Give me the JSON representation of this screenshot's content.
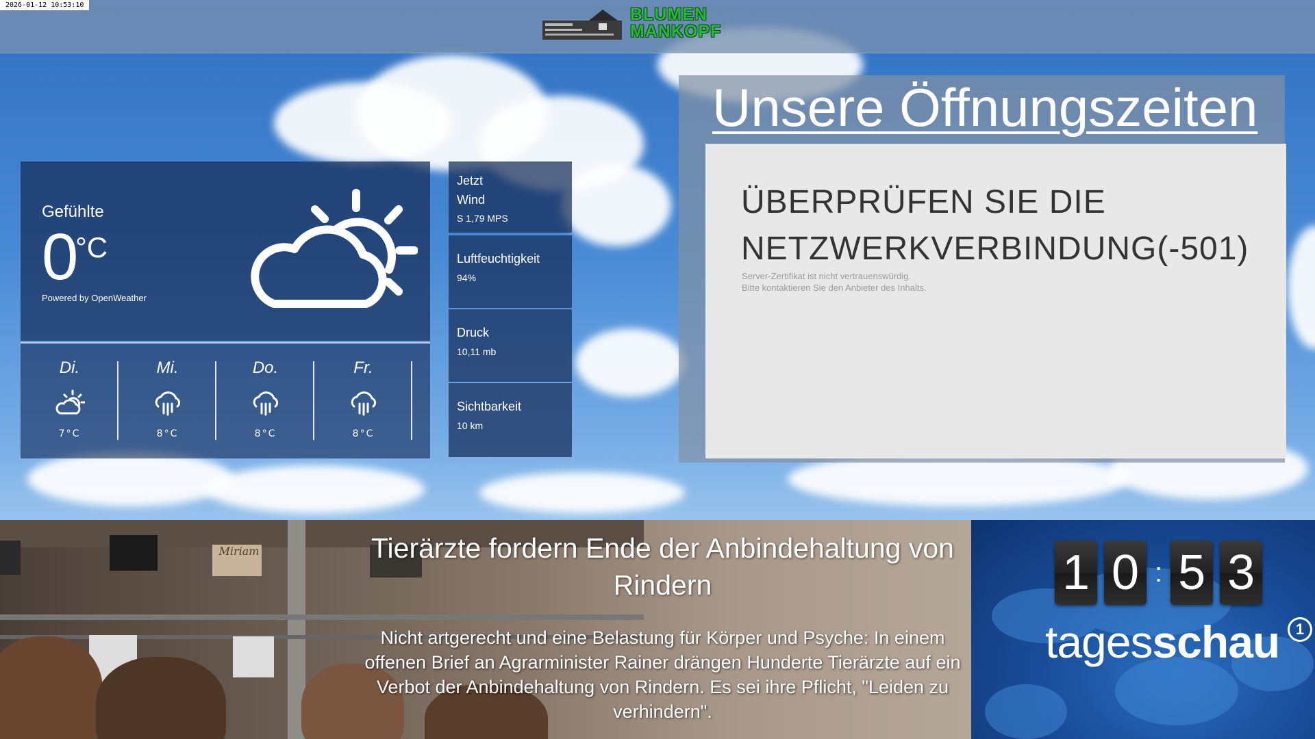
{
  "timestamp": "2026-01-12 10:53:10",
  "header": {
    "logo_line1": "BLUMEN",
    "logo_line2": "MANKOPF"
  },
  "weather": {
    "feels_label": "Gefühlte",
    "temperature": "0",
    "unit": "°C",
    "powered_by": "Powered by OpenWeather",
    "current_icon": "partly-cloudy-day-icon",
    "forecast": [
      {
        "day": "Di.",
        "icon": "partly-cloudy-day-icon",
        "temp": "7°C"
      },
      {
        "day": "Mi.",
        "icon": "rain-cloud-icon",
        "temp": "8°C"
      },
      {
        "day": "Do.",
        "icon": "rain-cloud-icon",
        "temp": "8°C"
      },
      {
        "day": "Fr.",
        "icon": "rain-cloud-icon",
        "temp": "8°C"
      }
    ],
    "stats": {
      "now_label": "Jetzt",
      "wind_label": "Wind",
      "wind_value": "S 1,79 MPS",
      "humidity_label": "Luftfeuchtigkeit",
      "humidity_value": "94%",
      "pressure_label": "Druck",
      "pressure_value": "10,11 mb",
      "visibility_label": "Sichtbarkeit",
      "visibility_value": "10 km"
    }
  },
  "hours": {
    "title": "Unsere Öffnungszeiten",
    "error_line1": "ÜBERPRÜFEN SIE DIE",
    "error_line2": "NETZWERKVERBINDUNG(-501)",
    "error_sub1": "Server-Zertifikat ist nicht vertrauenswürdig.",
    "error_sub2": "Bitte kontaktieren Sie den Anbieter des Inhalts."
  },
  "news": {
    "title": "Tierärzte fordern Ende der Anbindehaltung von Rindern",
    "body": "Nicht artgerecht und eine Belastung für Körper und Psyche: In einem offenen Brief an Agrarminister Rainer drängen Hunderte Tierärzte auf ein Verbot der Anbindehaltung von Rindern. Es sei ihre Pflicht, \"Leiden zu verhindern\".",
    "sign_text": "Miriam"
  },
  "clock": {
    "digits": [
      "1",
      "0",
      "5",
      "3"
    ],
    "separator": ":"
  },
  "tagesschau": {
    "logo_light": "tages",
    "logo_bold": "schau",
    "channel_mark": "1"
  },
  "colors": {
    "logo_green": "#25b83a",
    "panel_blue": "#162c58",
    "error_bg": "#e8e8e8",
    "ts_blue": "#1a4e9a"
  }
}
